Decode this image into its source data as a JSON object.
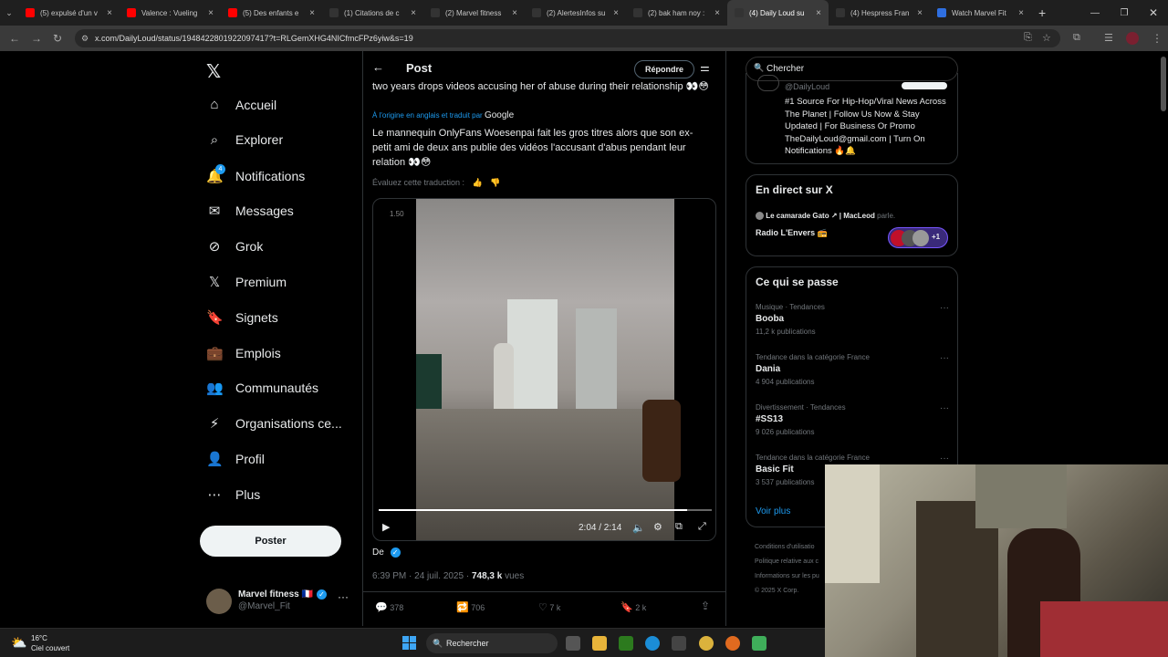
{
  "browser": {
    "tabs": [
      {
        "title": "(5) expulsé d'un v",
        "color": "#ff0000"
      },
      {
        "title": "Valence : Vueling",
        "color": "#ff0000"
      },
      {
        "title": "(5) Des enfants e",
        "color": "#ff0000"
      },
      {
        "title": "(1) Citations de c",
        "color": "#333333"
      },
      {
        "title": "(2) Marvel fitness",
        "color": "#333333"
      },
      {
        "title": "(2) AlertesInfos su",
        "color": "#333333"
      },
      {
        "title": "(2) bak ham noy :",
        "color": "#333333"
      },
      {
        "title": "(4) Daily Loud su",
        "color": "#333333"
      },
      {
        "title": "(4) Hespress Fran",
        "color": "#333333"
      },
      {
        "title": "Watch Marvel Fit",
        "color": "#2f6fe0"
      }
    ],
    "url": "x.com/DailyLoud/status/1948422801922097417?t=RLGemXHG4NICfmcFPz6yiw&s=19"
  },
  "sidebar": {
    "items": [
      {
        "label": "Accueil",
        "icon": "home-icon"
      },
      {
        "label": "Explorer",
        "icon": "search-icon"
      },
      {
        "label": "Notifications",
        "icon": "bell-icon",
        "badge": "4"
      },
      {
        "label": "Messages",
        "icon": "mail-icon"
      },
      {
        "label": "Grok",
        "icon": "grok-icon"
      },
      {
        "label": "Premium",
        "icon": "x-icon"
      },
      {
        "label": "Signets",
        "icon": "bookmark-icon"
      },
      {
        "label": "Emplois",
        "icon": "briefcase-icon"
      },
      {
        "label": "Communautés",
        "icon": "people-icon"
      },
      {
        "label": "Organisations ce...",
        "icon": "bolt-icon"
      },
      {
        "label": "Profil",
        "icon": "person-icon"
      },
      {
        "label": "Plus",
        "icon": "more-circle-icon"
      }
    ],
    "post_button": "Poster",
    "account": {
      "name": "Marvel fitness 🇫🇷",
      "handle": "@Marvel_Fit"
    }
  },
  "post": {
    "header": "Post",
    "reply_button": "Répondre",
    "original_text": "two years drops videos accusing her of abuse during their relationship 👀😳",
    "translated_note": "À l'origine en anglais et traduit par",
    "translated_by": "Google",
    "translated_text": "Le mannequin OnlyFans Woesenpai fait les gros titres alors que son ex-petit ami de deux ans publie des vidéos l'accusant d'abus pendant leur relation 👀😳",
    "rate_translation": "Évaluez cette traduction :",
    "video": {
      "speed": "1.50",
      "time": "2:04 / 2:14",
      "progress": 0.926
    },
    "from_label": "De",
    "timestamp": "6:39 PM · 24 juil. 2025 · ",
    "views": "748,3 k",
    "views_label": "vues",
    "stats": {
      "replies": "378",
      "reposts": "706",
      "likes": "7 k",
      "bookmarks": "2 k"
    }
  },
  "right": {
    "search_placeholder": "Chercher",
    "profile": {
      "handle": "@DailyLoud",
      "bio": "#1 Source For Hip-Hop/Viral News Across The Planet | Follow Us Now & Stay Updated | For Business Or Promo TheDailyLoud@gmail.com | Turn On Notifications 🔥🔔"
    },
    "live": {
      "title": "En direct sur X",
      "host": "Le camarade Gato ↗ | MacLeod",
      "host_suffix": "parle.",
      "room": "Radio L'Envers 📻",
      "more": "+1"
    },
    "trending": {
      "title": "Ce qui se passe",
      "items": [
        {
          "meta": "Musique · Tendances",
          "name": "Booba",
          "count": "11,2 k publications"
        },
        {
          "meta": "Tendance dans la catégorie France",
          "name": "Dania",
          "count": "4 904 publications"
        },
        {
          "meta": "Divertissement · Tendances",
          "name": "#SS13",
          "count": "9 026 publications"
        },
        {
          "meta": "Tendance dans la catégorie France",
          "name": "Basic Fit",
          "count": "3 537 publications"
        }
      ],
      "show_more": "Voir plus"
    },
    "footer": [
      "Conditions d'utilisatio",
      "Politique relative aux c",
      "Informations sur les pu",
      "© 2025 X Corp."
    ]
  },
  "taskbar": {
    "weather_temp": "16°C",
    "weather_desc": "Ciel couvert",
    "search": "Rechercher"
  }
}
